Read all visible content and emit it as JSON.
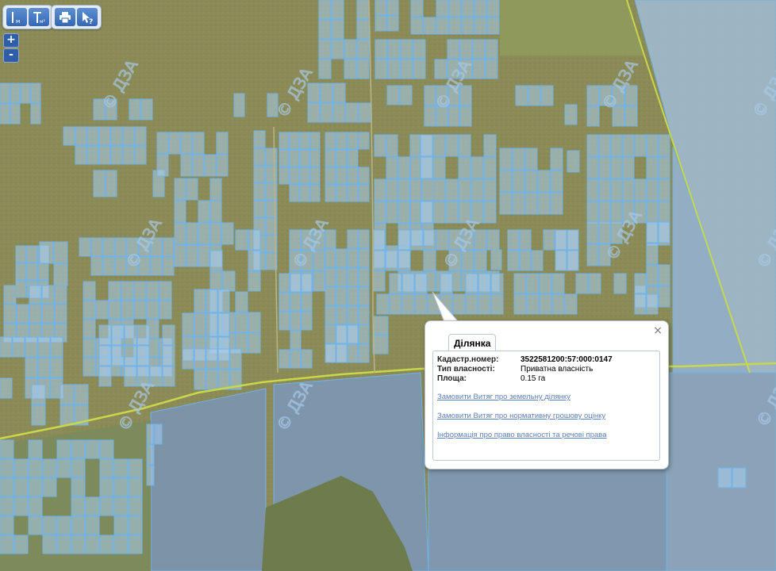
{
  "map": {
    "colors": {
      "field": "#8b8b57",
      "parcel_fill": "#a9cdef",
      "parcel_stroke": "#6fb3e8",
      "road": "#c8d84a",
      "large_parcel": "#7f98b0"
    },
    "watermark": "© ДЗА"
  },
  "toolbar": {
    "measure_icon": "ruler-line-icon",
    "measure_area_icon": "ruler-area-icon",
    "print_icon": "printer-icon",
    "info_icon": "pointer-question-icon"
  },
  "zoom": {
    "in_label": "+",
    "out_label": "-"
  },
  "popup": {
    "tab_label": "Ділянка",
    "close_label": "×",
    "fields": [
      {
        "label": "Кадастр.номер:",
        "value": "3522581200:57:000:0147"
      },
      {
        "label": "Тип власності:",
        "value": "Приватна власність"
      },
      {
        "label": "Площа:",
        "value": "0.15 га"
      }
    ],
    "links": [
      "Замовити Витяг про земельну ділянку",
      "Замовити Витяг про нормативну грошову оцінку",
      "Інформація про право власності та речові права"
    ]
  }
}
